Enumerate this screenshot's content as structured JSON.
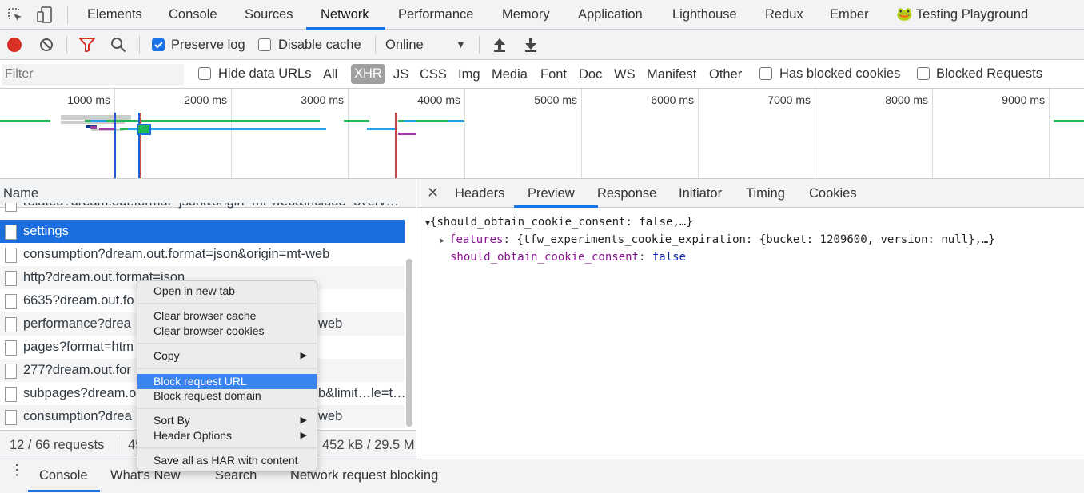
{
  "tabs": {
    "items": [
      "Elements",
      "Console",
      "Sources",
      "Network",
      "Performance",
      "Memory",
      "Application",
      "Lighthouse",
      "Redux",
      "Ember",
      "🐸 Testing Playground"
    ],
    "active": "Network"
  },
  "toolbar": {
    "preserve_log": "Preserve log",
    "preserve_log_checked": true,
    "disable_cache": "Disable cache",
    "disable_cache_checked": false,
    "throttle": "Online",
    "record_color": "#d93025"
  },
  "filters": {
    "placeholder": "Filter",
    "hide_data_urls": "Hide data URLs",
    "types": [
      "All",
      "XHR",
      "JS",
      "CSS",
      "Img",
      "Media",
      "Font",
      "Doc",
      "WS",
      "Manifest",
      "Other"
    ],
    "active_type": "XHR",
    "has_blocked_cookies": "Has blocked cookies",
    "blocked_requests": "Blocked Requests"
  },
  "overview": {
    "ticks": [
      "1000 ms",
      "2000 ms",
      "3000 ms",
      "4000 ms",
      "5000 ms",
      "6000 ms",
      "7000 ms",
      "8000 ms",
      "9000 ms"
    ]
  },
  "requests": {
    "header": "Name",
    "rows": [
      {
        "name": "related?dream.out.format=json&origin=mt-web&include=overv…",
        "right": ""
      },
      {
        "name": "settings",
        "right": "",
        "selected": true
      },
      {
        "name": "consumption?dream.out.format=json&origin=mt-web",
        "right": ""
      },
      {
        "name": "http?dream.out.format=json",
        "right": ""
      },
      {
        "name": "6635?dream.out.fo",
        "right": ""
      },
      {
        "name": "performance?drea",
        "right": "web"
      },
      {
        "name": "pages?format=htm",
        "right": ""
      },
      {
        "name": "277?dream.out.for",
        "right": ""
      },
      {
        "name": "subpages?dream.o",
        "right": "b&limit…le=t…"
      },
      {
        "name": "consumption?drea",
        "right": "web"
      }
    ]
  },
  "status": {
    "requests": "12 / 66 requests",
    "transferred": "45",
    "resources": "452 kB / 29.5 M"
  },
  "detail": {
    "tabs": [
      "Headers",
      "Preview",
      "Response",
      "Initiator",
      "Timing",
      "Cookies"
    ],
    "active": "Preview",
    "root": "{should_obtain_cookie_consent: false,…}",
    "features_key": "features",
    "features_val": "{tfw_experiments_cookie_expiration: {bucket: 1209600, version: null},…}",
    "consent_key": "should_obtain_cookie_consent",
    "consent_val": "false"
  },
  "context_menu": {
    "items": [
      "Open in new tab",
      "Clear browser cache",
      "Clear browser cookies",
      "Copy",
      "Block request URL",
      "Block request domain",
      "Sort By",
      "Header Options",
      "Save all as HAR with content"
    ],
    "highlighted": "Block request URL"
  },
  "drawer": {
    "tabs": [
      "Console",
      "What's New",
      "Search",
      "Network request blocking"
    ],
    "active": "Console"
  }
}
